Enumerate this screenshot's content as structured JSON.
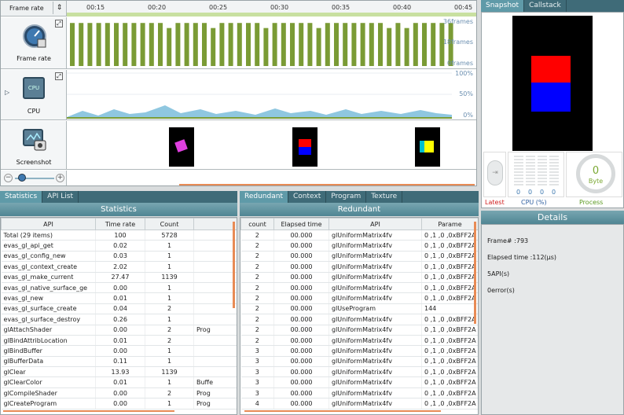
{
  "timeline": {
    "dropdown": "Frame rate",
    "ticks": [
      "00:15",
      "00:20",
      "00:25",
      "00:30",
      "00:35",
      "00:40",
      "00:45"
    ],
    "framerate": {
      "label": "Frame rate",
      "y_labels": [
        "36frames",
        "18frames",
        "0frames"
      ],
      "bars": [
        34,
        34,
        34,
        34,
        34,
        34,
        34,
        34,
        34,
        34,
        34,
        30,
        34,
        34,
        34,
        34,
        30,
        34,
        34,
        34,
        34,
        34,
        30,
        34,
        34,
        34,
        34,
        34,
        30,
        34,
        34,
        34,
        34,
        34,
        34,
        34,
        30,
        34,
        30,
        34,
        34,
        34,
        34,
        34
      ]
    },
    "cpu": {
      "label": "CPU",
      "icon_text": "CPU",
      "y_labels": [
        "100%",
        "50%",
        "0%"
      ]
    },
    "screenshot": {
      "label": "Screenshot"
    },
    "colors": {
      "bar": "#7a9b35",
      "cpu": "#8fc7e0",
      "thumb_magenta": "#e040e0",
      "thumb_red": "#ff0000",
      "thumb_blue": "#0000ff",
      "thumb_yellow": "#ffff00",
      "thumb_cyan": "#00c0d0"
    }
  },
  "snapshot": {
    "tabs": [
      "Snapshot",
      "Callstack"
    ],
    "gauge_value": "0",
    "gauge_unit": "Byte",
    "cpu_vals": [
      "0",
      "0",
      "0",
      "0"
    ],
    "labels": [
      "Latest",
      "CPU (%)",
      "Process"
    ]
  },
  "details": {
    "title": "Details",
    "lines": [
      "Frame# :793",
      "Elapsed time :112(μs)",
      "5API(s)",
      "0error(s)"
    ]
  },
  "statistics": {
    "tabs": [
      "Statistics",
      "API List"
    ],
    "title": "Statistics",
    "columns": [
      "API",
      "Time rate",
      "Count"
    ],
    "rows": [
      [
        "Total (29 items)",
        "100",
        "5728",
        ""
      ],
      [
        "evas_gl_api_get",
        "0.02",
        "1",
        ""
      ],
      [
        "evas_gl_config_new",
        "0.03",
        "1",
        ""
      ],
      [
        "evas_gl_context_create",
        "2.02",
        "1",
        ""
      ],
      [
        "evas_gl_make_current",
        "27.47",
        "1139",
        ""
      ],
      [
        "evas_gl_native_surface_ge",
        "0.00",
        "1",
        ""
      ],
      [
        "evas_gl_new",
        "0.01",
        "1",
        ""
      ],
      [
        "evas_gl_surface_create",
        "0.04",
        "2",
        ""
      ],
      [
        "evas_gl_surface_destroy",
        "0.26",
        "1",
        ""
      ],
      [
        "glAttachShader",
        "0.00",
        "2",
        "Prog"
      ],
      [
        "glBindAttribLocation",
        "0.01",
        "2",
        ""
      ],
      [
        "glBindBuffer",
        "0.00",
        "1",
        ""
      ],
      [
        "glBufferData",
        "0.11",
        "1",
        ""
      ],
      [
        "glClear",
        "13.93",
        "1139",
        ""
      ],
      [
        "glClearColor",
        "0.01",
        "1",
        "Buffe"
      ],
      [
        "glCompileShader",
        "0.00",
        "2",
        "Prog"
      ],
      [
        "glCreateProgram",
        "0.00",
        "1",
        "Prog"
      ]
    ]
  },
  "redundant": {
    "tabs": [
      "Redundant",
      "Context",
      "Program",
      "Texture"
    ],
    "title": "Redundant",
    "columns": [
      "count",
      "Elapsed time",
      "API",
      "Parame"
    ],
    "rows": [
      [
        "2",
        "00.000",
        "glUniformMatrix4fv",
        "0 ,1 ,0 ,0xBFF2A"
      ],
      [
        "2",
        "00.000",
        "glUniformMatrix4fv",
        "0 ,1 ,0 ,0xBFF2A"
      ],
      [
        "2",
        "00.000",
        "glUniformMatrix4fv",
        "0 ,1 ,0 ,0xBFF2A"
      ],
      [
        "2",
        "00.000",
        "glUniformMatrix4fv",
        "0 ,1 ,0 ,0xBFF2A"
      ],
      [
        "2",
        "00.000",
        "glUniformMatrix4fv",
        "0 ,1 ,0 ,0xBFF2A"
      ],
      [
        "2",
        "00.000",
        "glUniformMatrix4fv",
        "0 ,1 ,0 ,0xBFF2A"
      ],
      [
        "2",
        "00.000",
        "glUniformMatrix4fv",
        "0 ,1 ,0 ,0xBFF2A"
      ],
      [
        "2",
        "00.000",
        "glUseProgram",
        "144"
      ],
      [
        "2",
        "00.000",
        "glUniformMatrix4fv",
        "0 ,1 ,0 ,0xBFF2A"
      ],
      [
        "2",
        "00.000",
        "glUniformMatrix4fv",
        "0 ,1 ,0 ,0xBFF2A"
      ],
      [
        "2",
        "00.000",
        "glUniformMatrix4fv",
        "0 ,1 ,0 ,0xBFF2A"
      ],
      [
        "3",
        "00.000",
        "glUniformMatrix4fv",
        "0 ,1 ,0 ,0xBFF2A"
      ],
      [
        "3",
        "00.000",
        "glUniformMatrix4fv",
        "0 ,1 ,0 ,0xBFF2A"
      ],
      [
        "3",
        "00.000",
        "glUniformMatrix4fv",
        "0 ,1 ,0 ,0xBFF2A"
      ],
      [
        "3",
        "00.000",
        "glUniformMatrix4fv",
        "0 ,1 ,0 ,0xBFF2A"
      ],
      [
        "3",
        "00.000",
        "glUniformMatrix4fv",
        "0 ,1 ,0 ,0xBFF2A"
      ],
      [
        "4",
        "00.000",
        "glUniformMatrix4fv",
        "0 ,1 ,0 ,0xBFF2A"
      ]
    ]
  }
}
